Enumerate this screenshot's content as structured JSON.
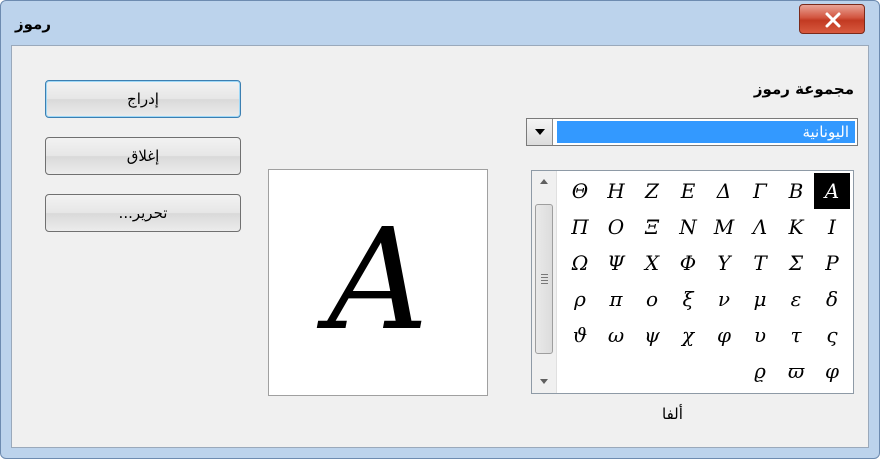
{
  "window": {
    "title": "رموز"
  },
  "buttons": {
    "insert": "إدراج",
    "close": "إغلاق",
    "edit": "تحرير..."
  },
  "symbol_set": {
    "label": "مجموعة رموز",
    "value": "اليونانية"
  },
  "preview": {
    "glyph": "A"
  },
  "character_name": "ألفا",
  "symbol_rows": [
    [
      "Α",
      "Β",
      "Γ",
      "Δ",
      "Ε",
      "Ζ",
      "Η",
      "Θ"
    ],
    [
      "Ι",
      "Κ",
      "Λ",
      "Μ",
      "Ν",
      "Ξ",
      "Ο",
      "Π"
    ],
    [
      "Ρ",
      "Σ",
      "Τ",
      "Υ",
      "Φ",
      "Χ",
      "Ψ",
      "Ω"
    ],
    [
      "δ",
      "ε",
      "μ",
      "ν",
      "ξ",
      "ο",
      "π",
      "ρ"
    ],
    [
      "ς",
      "τ",
      "υ",
      "φ",
      "χ",
      "ψ",
      "ω",
      "ϑ"
    ],
    [
      "φ",
      "ϖ",
      "ϱ",
      "",
      "",
      "",
      "",
      ""
    ]
  ],
  "selected_symbol": "Α",
  "icons": {
    "close": "close-icon",
    "dropdown": "chevron-down-icon",
    "scroll_up": "arrow-up-icon",
    "scroll_down": "arrow-down-icon"
  }
}
